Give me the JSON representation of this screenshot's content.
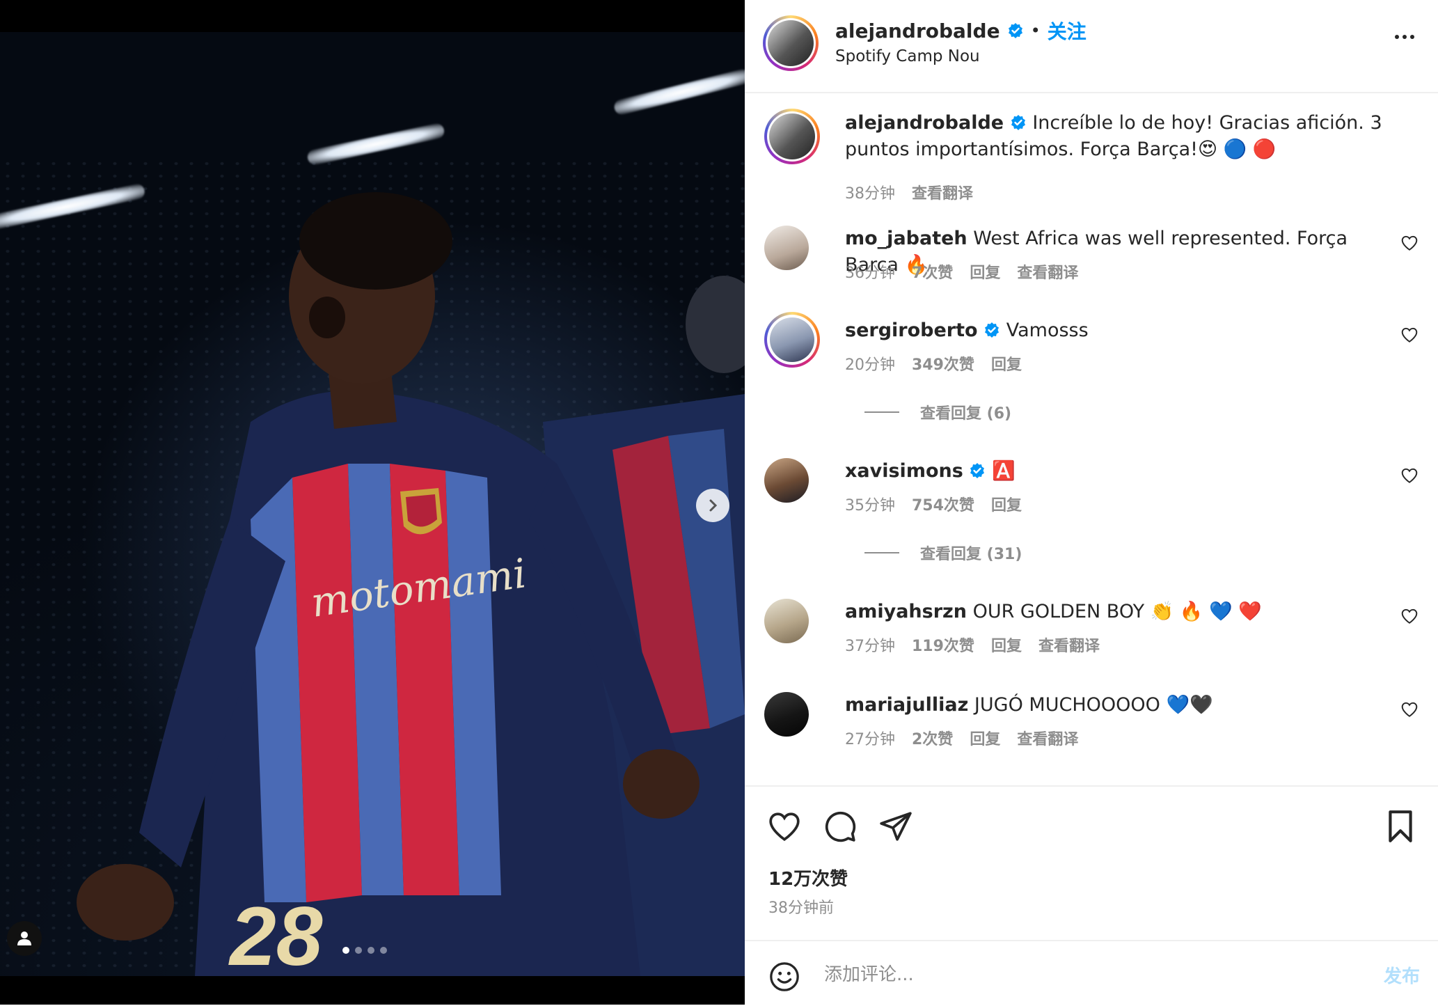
{
  "post": {
    "username": "alejandrobalde",
    "verified": true,
    "follow_separator": "•",
    "follow_label": "关注",
    "location": "Spotify Camp Nou",
    "caption": "Increíble lo de hoy! Gracias afición. 3 puntos importantísimos. Força Barça!😍 🔵 🔴",
    "caption_time": "38分钟",
    "caption_translate": "查看翻译"
  },
  "media": {
    "carousel_count": 4,
    "carousel_active_index": 0
  },
  "comments": [
    {
      "username": "mo_jabateh",
      "verified": false,
      "text": "West Africa was well represented. Força Barca 🔥",
      "time": "36分钟",
      "likes": "7次赞",
      "reply": "回复",
      "translate": "查看翻译",
      "view_replies": ""
    },
    {
      "username": "sergiroberto",
      "verified": true,
      "text": "Vamosss",
      "time": "20分钟",
      "likes": "349次赞",
      "reply": "回复",
      "translate": "",
      "view_replies": "查看回复 (6)"
    },
    {
      "username": "xavisimons",
      "verified": true,
      "text": "🅰️",
      "time": "35分钟",
      "likes": "754次赞",
      "reply": "回复",
      "translate": "",
      "view_replies": "查看回复 (31)"
    },
    {
      "username": "amiyahsrzn",
      "verified": false,
      "text": "OUR GOLDEN BOY 👏 🔥 💙 ❤️",
      "time": "37分钟",
      "likes": "119次赞",
      "reply": "回复",
      "translate": "查看翻译",
      "view_replies": ""
    },
    {
      "username": "mariajulliaz",
      "verified": false,
      "text": "JUGÓ MUCHOOOOO 💙🖤",
      "time": "27分钟",
      "likes": "2次赞",
      "reply": "回复",
      "translate": "查看翻译",
      "view_replies": ""
    }
  ],
  "footer": {
    "likes": "12万次赞",
    "time": "38分钟前",
    "comment_placeholder": "添加评论...",
    "post_label": "发布"
  },
  "icons": {
    "like": "heart-icon",
    "comment": "comment-icon",
    "share": "send-icon",
    "save": "bookmark-icon",
    "emoji": "emoji-icon",
    "more": "more-icon",
    "next": "chevron-right-icon",
    "tag": "user-tag-icon"
  },
  "colors": {
    "accent": "#0095f6",
    "verified": "#0095f6",
    "muted": "#8e8e8e",
    "post_disabled": "#b2dffc"
  }
}
